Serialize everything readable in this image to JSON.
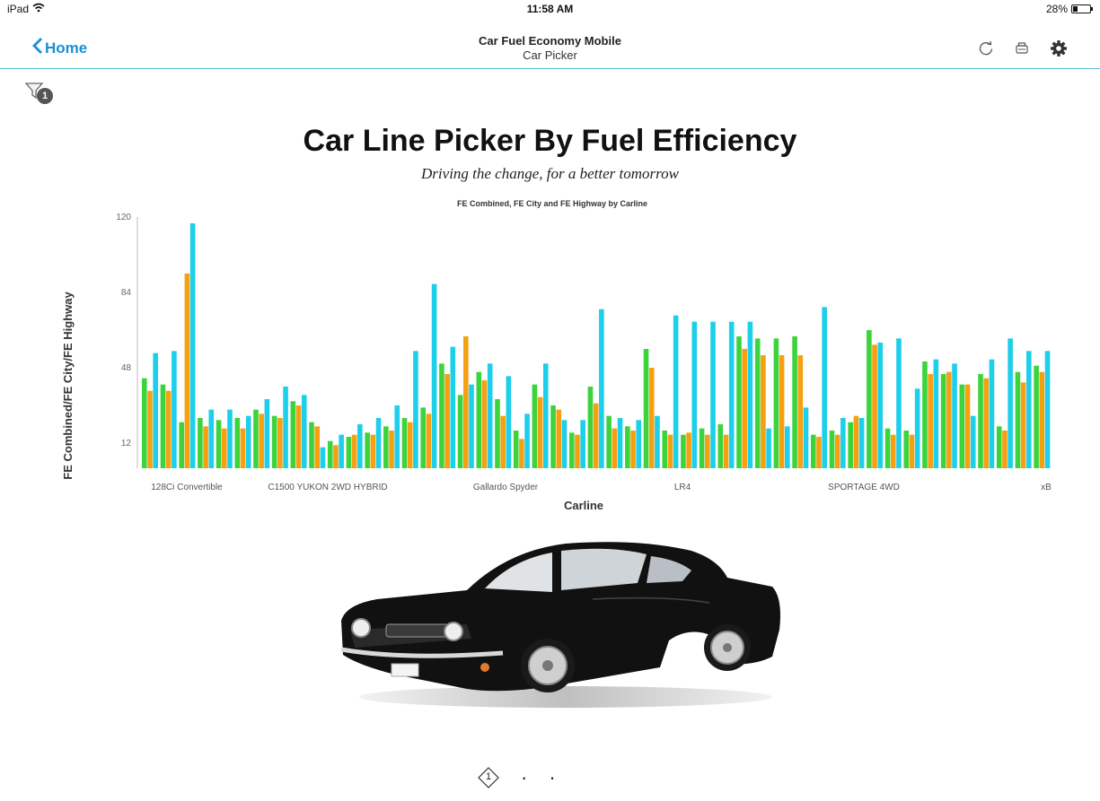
{
  "status_bar": {
    "device": "iPad",
    "time": "11:58 AM",
    "battery_pct": "28%",
    "battery_level": 0.28
  },
  "nav": {
    "back_label": "Home",
    "title": "Car Fuel Economy Mobile",
    "subtitle": "Car Picker"
  },
  "icons": {
    "refresh": "refresh-icon",
    "print": "print-icon",
    "settings": "gear-icon",
    "filter": "filter-icon",
    "back": "chevron-left-icon",
    "wifi": "wifi-icon"
  },
  "filter_count": "1",
  "heading": {
    "title": "Car Line Picker By Fuel Efficiency",
    "tagline": "Driving the change, for a better tomorrow"
  },
  "colors": {
    "accent": "#1a8fd6",
    "divider": "#5bc1d8",
    "series_green": "#3cd43c",
    "series_orange": "#f5a011",
    "series_cyan": "#1ccfea"
  },
  "chart_data": {
    "type": "bar",
    "title": "FE Combined, FE City and FE Highway by Carline",
    "xlabel": "Carline",
    "ylabel": "FE Combined/FE City/FE Highway",
    "ylim": [
      0,
      120
    ],
    "yticks": [
      12,
      48,
      84,
      120
    ],
    "category_labels": [
      "128Ci Convertible",
      "C1500 YUKON 2WD HYBRID",
      "Gallardo Spyder",
      "LR4",
      "SPORTAGE 4WD",
      "xB"
    ],
    "grid": false,
    "series": [
      {
        "color": "#3cd43c",
        "values": [
          43,
          40,
          22,
          24,
          23,
          24,
          28,
          25,
          32,
          22,
          13,
          15,
          17,
          20,
          24,
          29,
          50,
          35,
          46,
          33,
          18,
          40,
          30,
          17,
          39,
          25,
          20,
          57,
          18,
          16,
          19,
          21,
          63,
          62,
          62,
          63,
          16,
          18,
          22,
          66,
          19,
          18,
          51,
          45,
          40,
          45,
          20,
          46,
          49
        ]
      },
      {
        "color": "#f5a011",
        "values": [
          37,
          37,
          93,
          20,
          19,
          19,
          26,
          24,
          30,
          20,
          11,
          16,
          16,
          18,
          22,
          26,
          45,
          63,
          42,
          25,
          14,
          34,
          28,
          16,
          31,
          19,
          18,
          48,
          16,
          17,
          16,
          16,
          57,
          54,
          54,
          54,
          15,
          16,
          25,
          59,
          16,
          16,
          45,
          46,
          40,
          43,
          18,
          41,
          46
        ]
      },
      {
        "color": "#1ccfea",
        "values": [
          55,
          56,
          117,
          28,
          28,
          25,
          33,
          39,
          35,
          10,
          16,
          21,
          24,
          30,
          56,
          88,
          58,
          40,
          50,
          44,
          26,
          50,
          23,
          23,
          76,
          24,
          23,
          25,
          73,
          70,
          70,
          70,
          70,
          19,
          20,
          29,
          77,
          24,
          24,
          60,
          62,
          38,
          52,
          50,
          25,
          52,
          62,
          56,
          56
        ]
      }
    ]
  },
  "pager": {
    "current": "1",
    "total_pages": 3
  }
}
